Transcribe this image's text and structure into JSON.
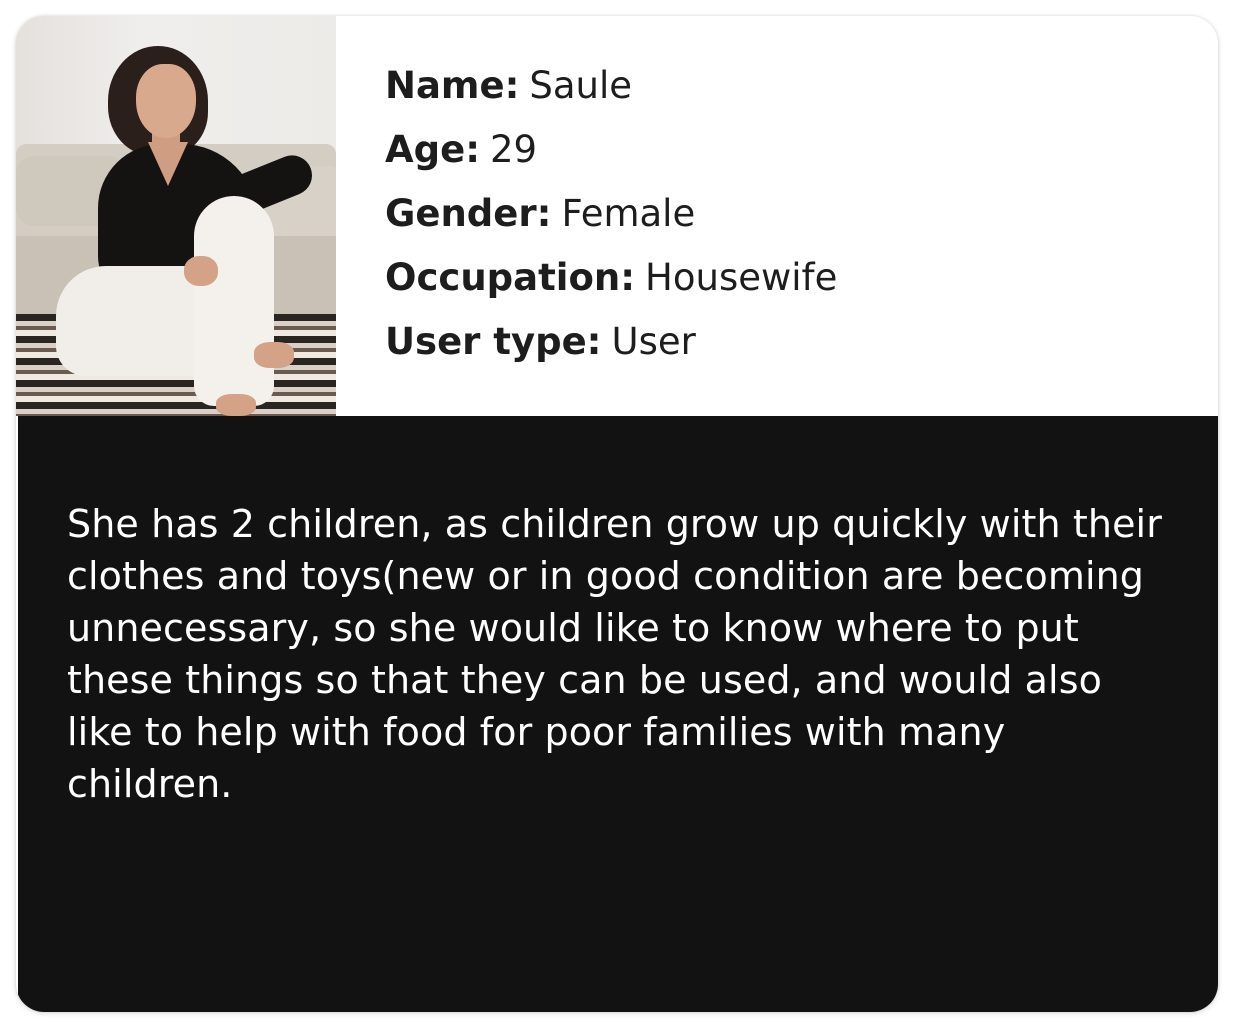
{
  "persona": {
    "photo_alt": "Photo of Saule",
    "fields": [
      {
        "label": "Name:",
        "value": "Saule"
      },
      {
        "label": "Age:",
        "value": "29"
      },
      {
        "label": "Gender:",
        "value": "Female"
      },
      {
        "label": "Occupation:",
        "value": "Housewife"
      },
      {
        "label": "User type:",
        "value": "User"
      }
    ],
    "description": "She has 2 children, as children grow up quickly with their clothes and toys(new or in good condition are becoming unnecessary, so she would like to know where to put these things so that they can be used, and would also like to help with food for poor families with many children."
  },
  "colors": {
    "panel_dark": "#121212",
    "text_dark": "#1d1d1d",
    "text_light": "#ffffff"
  }
}
